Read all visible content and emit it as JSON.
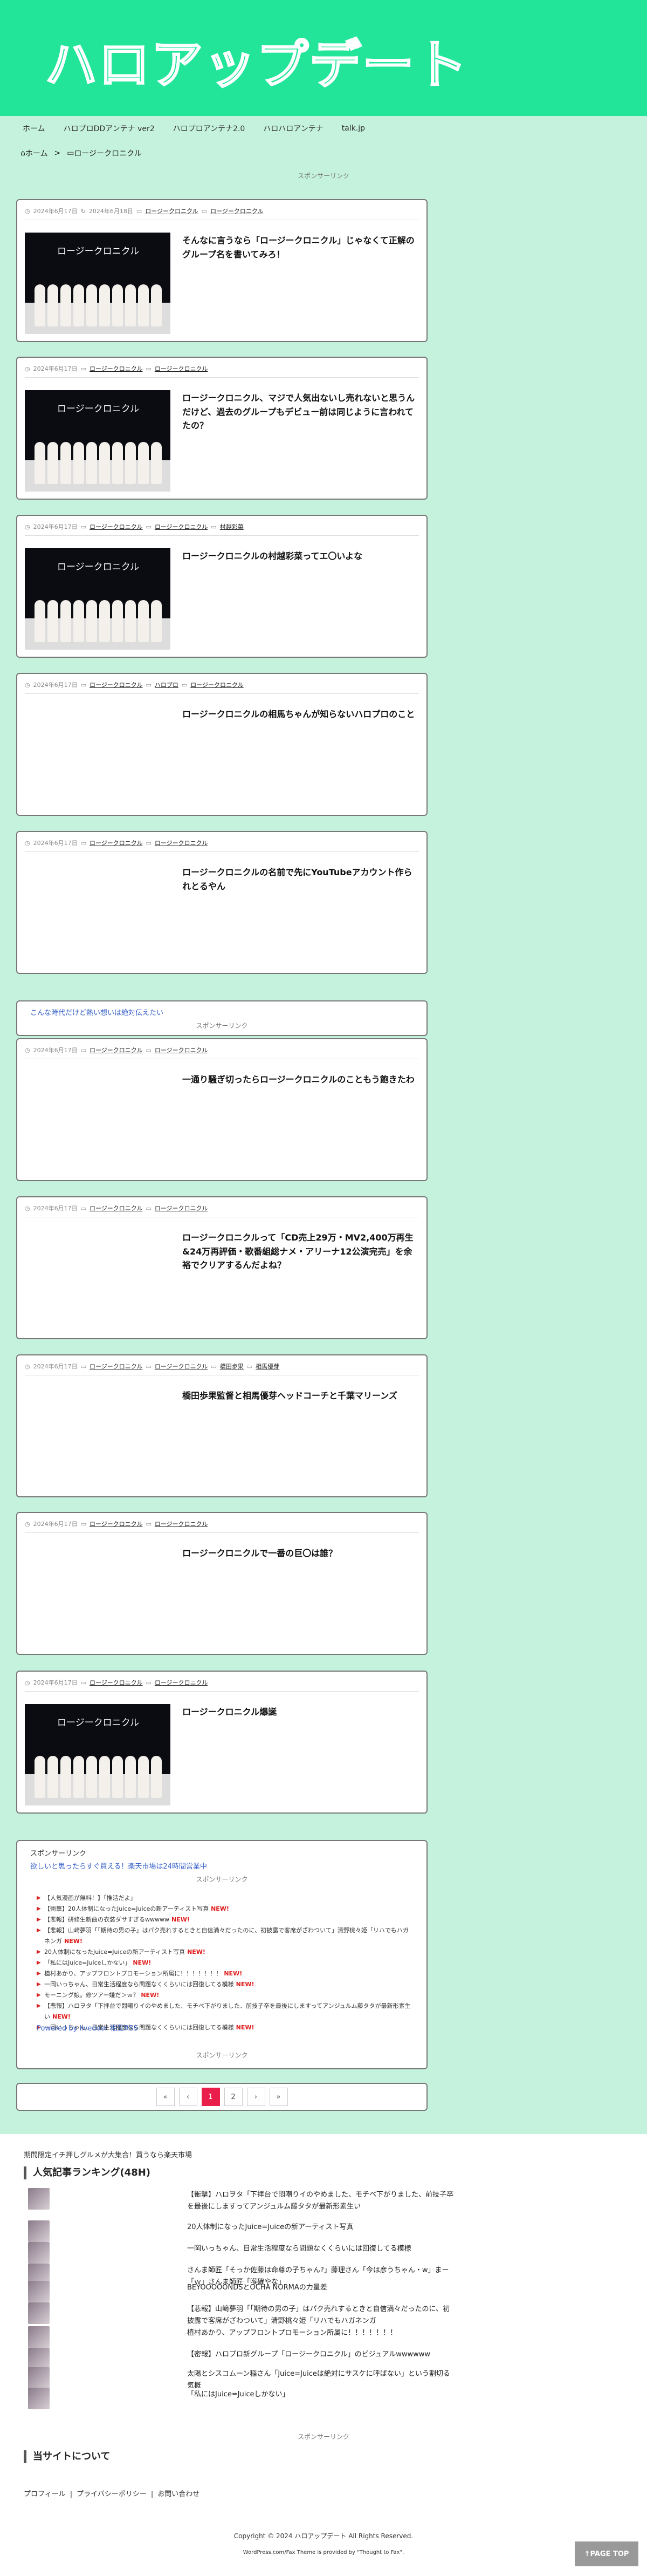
{
  "header": {
    "site_title": "ハロアップデート"
  },
  "nav": {
    "items": [
      "ホーム",
      "ハロプロDDアンテナ ver2",
      "ハロプロアンテナ2.0",
      "ハロハロアンテナ",
      "talk.jp"
    ]
  },
  "breadcrumb": {
    "home": "ホーム",
    "separator": ">",
    "current": "ロージークロニクル"
  },
  "sponsor_label": "スポンサーリンク",
  "thumbnail_caption": "ロージークロニクル",
  "posts": [
    {
      "date": "2024年6月17日",
      "updated": "2024年6月18日",
      "cats": [
        "ロージークロニクル",
        "ロージークロニクル"
      ],
      "title": "そんなに言うなら「ロージークロニクル」じゃなくて正解のグループ名を書いてみろ！"
    },
    {
      "date": "2024年6月17日",
      "updated": "",
      "cats": [
        "ロージークロニクル",
        "ロージークロニクル"
      ],
      "title": "ロージークロニクル、マジで人気出ないし売れないと思うんだけど、過去のグループもデビュー前は同じように言われてたの？"
    },
    {
      "date": "2024年6月17日",
      "updated": "",
      "cats": [
        "ロージークロニクル",
        "ロージークロニクル",
        "村越彩菜"
      ],
      "title": "ロージークロニクルの村越彩菜ってエ〇いよな"
    },
    {
      "date": "2024年6月17日",
      "updated": "",
      "cats": [
        "ロージークロニクル",
        "ハロプロ",
        "ロージークロニクル"
      ],
      "title": "ロージークロニクルの相馬ちゃんが知らないハロプロのこと"
    },
    {
      "date": "2024年6月17日",
      "updated": "",
      "cats": [
        "ロージークロニクル",
        "ロージークロニクル"
      ],
      "title": "ロージークロニクルの名前で先にYouTubeアカウント作られとるやん"
    },
    {
      "date": "2024年6月17日",
      "updated": "",
      "cats": [
        "ロージークロニクル",
        "ロージークロニクル"
      ],
      "title": "一通り騒ぎ切ったらロージークロニクルのこともう飽きたわ"
    },
    {
      "date": "2024年6月17日",
      "updated": "",
      "cats": [
        "ロージークロニクル",
        "ロージークロニクル"
      ],
      "title": "ロージークロニクルって「CD売上29万・MV2,400万再生&24万再評価・歌番組総ナメ・アリーナ12公演完売」を余裕でクリアするんだよね？"
    },
    {
      "date": "2024年6月17日",
      "updated": "",
      "cats": [
        "ロージークロニクル",
        "ロージークロニクル",
        "橋田歩果",
        "相馬優芽"
      ],
      "title": "橋田歩果監督と相馬優芽ヘッドコーチと千葉マリーンズ"
    },
    {
      "date": "2024年6月17日",
      "updated": "",
      "cats": [
        "ロージークロニクル",
        "ロージークロニクル"
      ],
      "title": "ロージークロニクルで一番の巨〇は誰？"
    },
    {
      "date": "2024年6月17日",
      "updated": "",
      "cats": [
        "ロージークロニクル",
        "ロージークロニクル"
      ],
      "title": "ロージークロニクル爆誕"
    }
  ],
  "mid_ad": {
    "text": "こんな時代だけど熱い想いは絶対伝えたい",
    "label": "スポンサーリンク"
  },
  "ranking_box": {
    "heading": "スポンサーリンク",
    "promo": "欲しいと思ったらすぐ買える！楽天市場は24時間営業中",
    "label": "スポンサーリンク",
    "new_badge": "NEW!",
    "items": [
      {
        "text": "【人気漫画が無料！】「推活だよ」",
        "new": false
      },
      {
        "text": "【衝撃】20人体制になったJuice=Juiceの新アーティスト写真",
        "new": true
      },
      {
        "text": "【悲報】研修生新曲の衣装ダサすぎるwwwww",
        "new": true
      },
      {
        "text": "【悲報】山﨑夢羽「「期待の男の子」はパク売れするときと自信満々だったのに、初披露で客席がざわついて」清野桃々姫「リハでもハガネンガ",
        "new": true
      },
      {
        "text": "20人体制になったJuice=Juiceの新アーティスト写真",
        "new": true
      },
      {
        "text": "「私にはJuice=Juiceしかない」",
        "new": true
      },
      {
        "text": "植村あかり、アップフロントプロモーション所属に！！！！！！！",
        "new": true
      },
      {
        "text": "一岡いっちゃん、日常生活程度なら問題なくくらいには回復してる模様",
        "new": true
      },
      {
        "text": "モーニング娘。修ツアー嫌だ＞ｗ？",
        "new": true
      },
      {
        "text": "【悲報】ハロヲタ「下拝台で悶嘲りイのやめました、モチベ下がりました、前技子卒を最後にしますってアンジュルム藤タタが最新形素生い",
        "new": true
      },
      {
        "text": "一岡いっちゃん、日常生活程度なら問題なくくらいには回復してる模様",
        "new": true
      }
    ],
    "powered": "Powered by livedoor 相互RSS",
    "bottom_label": "スポンサーリンク"
  },
  "pagination": {
    "prev2": "«",
    "prev": "‹",
    "current": "1",
    "next_page": "2",
    "next": "›",
    "last": "»"
  },
  "footer": {
    "ad_text": "期間限定イチ押しグルメが大集合！買うなら楽天市場",
    "ranking_heading": "人気記事ランキング(48H)",
    "ranking": [
      "【衝撃】ハロヲタ「下拝台で悶嘲りイのやめました、モチベ下がりました、前技子卒を最後にしますってアンジュルム藤タタが最新形素生い",
      "20人体制になったJuice=Juiceの新アーティスト写真",
      "一岡いっちゃん、日常生活程度なら問題なくくらいには回復してる模様",
      "さんま師匠「そっか佐藤は命尊の子ちゃん?」藤理さん「今は彦うちゃん・w」まー「ｗ」さんま師匠「喉確やな」",
      "BEYOOOOONDSとOCHA NORMAの力量差",
      "【悲報】山﨑夢羽「「期待の男の子」はパク売れするときと自信満々だったのに、初披露で客席がざわついて」清野桃々姫「リハでもハガネンガ",
      "植村あかり、アップフロントプロモーション所属に！！！！！！！",
      "【密報】ハロプロ新グループ「ロージークロニクル」のビジュアルwwwwww",
      "太陽とシスコムーン稲さん「Juice=Juiceは絶対にサスケに呼ばない」という割切る気概",
      "「私にはJuice=Juiceしかない」"
    ],
    "bottom_label": "スポンサーリンク",
    "about_heading": "当サイトについて",
    "links": [
      "プロフィール",
      "プライバシーポリシー",
      "お問い合わせ"
    ],
    "copyright": "Copyright © 2024 ハロアップデート All Rights Reserved.",
    "powered": "WordPress.com/Fax Theme is provided by \"Thought to Fax\".",
    "page_top": "PAGE TOP"
  }
}
